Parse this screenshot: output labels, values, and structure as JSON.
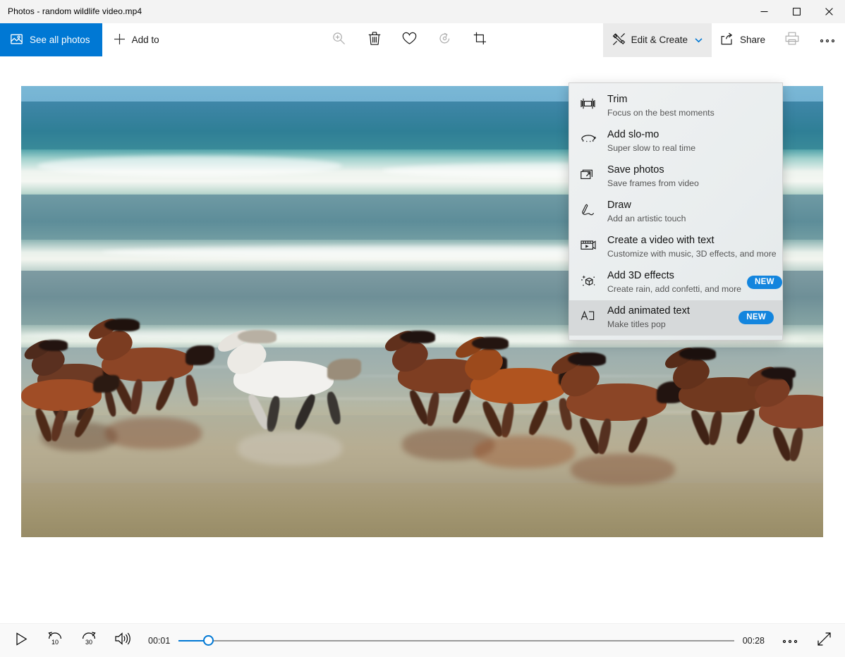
{
  "window": {
    "title": "Photos - random wildlife video.mp4",
    "controls": {
      "minimize": "Minimize",
      "maximize": "Maximize",
      "close": "Close"
    }
  },
  "command_bar": {
    "see_all_photos": "See all photos",
    "add_to": "Add to",
    "center_icons": [
      {
        "name": "zoom-in-icon",
        "label": "Zoom in",
        "disabled": true
      },
      {
        "name": "delete-icon",
        "label": "Delete",
        "disabled": false
      },
      {
        "name": "heart-icon",
        "label": "Add to favorites",
        "disabled": false
      },
      {
        "name": "rotate-icon",
        "label": "Rotate",
        "disabled": true
      },
      {
        "name": "crop-icon",
        "label": "Crop",
        "disabled": false
      }
    ],
    "edit_create": "Edit & Create",
    "share": "Share",
    "print": "Print",
    "see_more": "See more"
  },
  "edit_create_menu": {
    "items": [
      {
        "icon": "trim-icon",
        "title": "Trim",
        "subtitle": "Focus on the best moments",
        "badge": "",
        "highlighted": false
      },
      {
        "icon": "turtle-slomo-icon",
        "title": "Add slo-mo",
        "subtitle": "Super slow to real time",
        "badge": "",
        "highlighted": false
      },
      {
        "icon": "save-photos-icon",
        "title": "Save photos",
        "subtitle": "Save frames from video",
        "badge": "",
        "highlighted": false
      },
      {
        "icon": "draw-pen-icon",
        "title": "Draw",
        "subtitle": "Add an artistic touch",
        "badge": "",
        "highlighted": false
      },
      {
        "icon": "video-with-text-icon",
        "title": "Create a video with text",
        "subtitle": "Customize with music, 3D effects, and more",
        "badge": "",
        "highlighted": false
      },
      {
        "icon": "3d-effects-icon",
        "title": "Add 3D effects",
        "subtitle": "Create rain, add confetti, and more",
        "badge": "NEW",
        "highlighted": false
      },
      {
        "icon": "animated-text-icon",
        "title": "Add animated text",
        "subtitle": "Make titles pop",
        "badge": "NEW",
        "highlighted": true
      }
    ]
  },
  "video": {
    "description": "Herd of horses galloping through shallow water on a beach with ocean surf behind"
  },
  "playback": {
    "play": "Play",
    "rewind_label": "10",
    "forward_label": "30",
    "volume": "Volume",
    "current_time": "00:01",
    "duration": "00:28",
    "progress_percent": 5.4,
    "more_options": "More options",
    "fullscreen": "Full screen"
  },
  "colors": {
    "accent": "#0078d4",
    "badge": "#1385de",
    "menu_bg": "#ebeeef",
    "menu_highlight": "#d6d9da",
    "titlebar_bg": "#f3f3f3",
    "playbar_bg": "#f9f9f9"
  }
}
